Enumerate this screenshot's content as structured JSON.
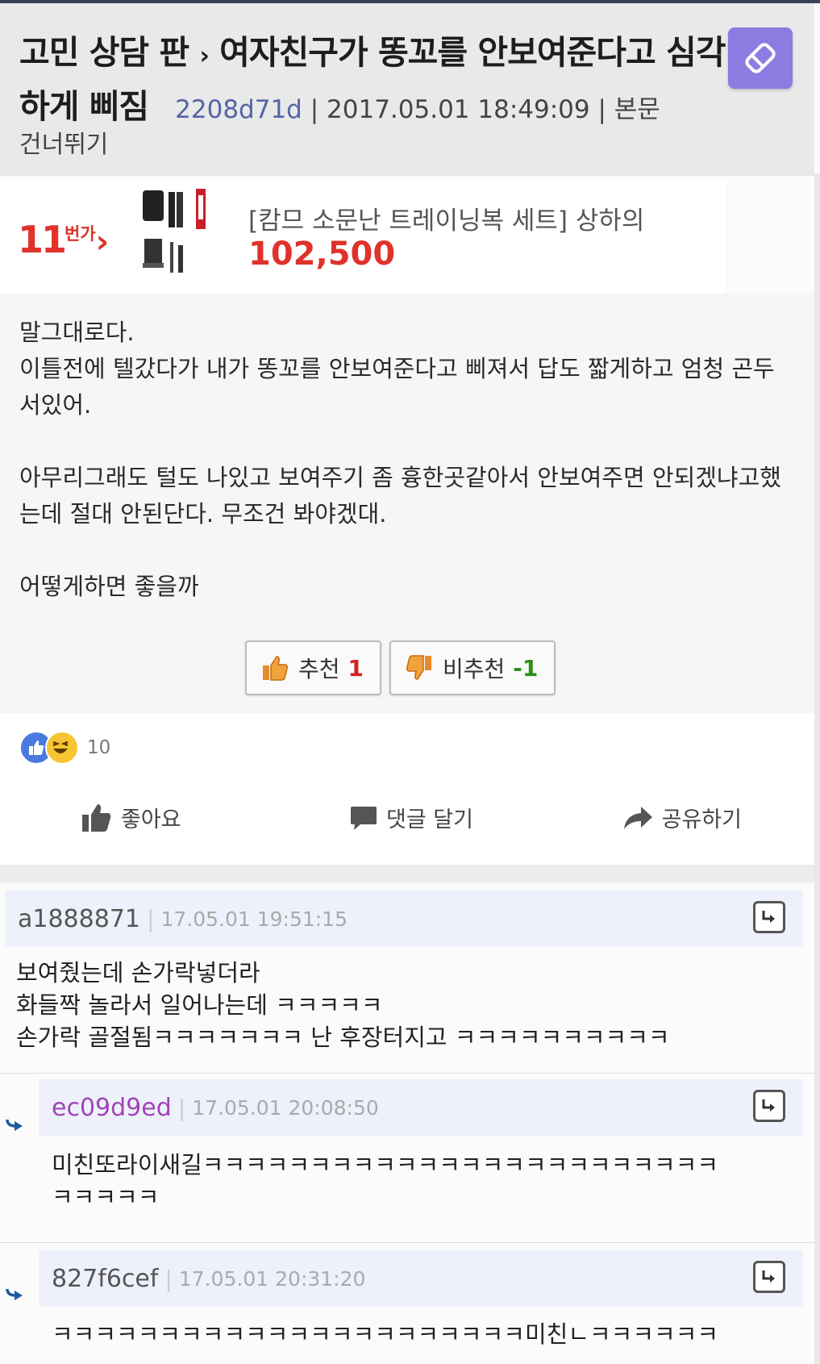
{
  "header": {
    "board": "고민 상담 판",
    "separator": "›",
    "title": "여자친구가 똥꼬를 안보여준다고 심각하게 삐짐",
    "author": "2208d71d",
    "datetime": "2017.05.01 18:49:09",
    "skip_label_1": "본문",
    "skip_label_2": "건너뛰기",
    "write_icon": "pencil-eraser-icon"
  },
  "ad": {
    "logo": "11",
    "logo_suffix": "번가",
    "product_name": "[캄므 소문난 트레이닝복 세트] 상하의",
    "price": "102,500"
  },
  "post": {
    "lines": [
      "말그대로다.",
      "이틀전에 텔갔다가 내가 똥꼬를 안보여준다고 삐져서 답도 짧게하고 엄청 곤두서있어.",
      "",
      "아무리그래도 털도 나있고 보여주기 좀 흉한곳같아서 안보여주면 안되겠냐고했는데 절대 안된단다. 무조건 봐야겠대.",
      "",
      "어떻게하면 좋을까"
    ],
    "upvote_label": "추천",
    "upvote_count": "1",
    "downvote_label": "비추천",
    "downvote_count": "-1"
  },
  "social": {
    "reaction_count": "10",
    "like_label": "좋아요",
    "comment_label": "댓글 달기",
    "share_label": "공유하기"
  },
  "comments": [
    {
      "id": "a1888871",
      "time": "17.05.01 19:51:15",
      "body": "보여줬는데 손가락넣더라\n화들짝 놀라서 일어나는데 ㅋㅋㅋㅋㅋ\n손가락 골절됨ㅋㅋㅋㅋㅋㅋㅋ 난 후장터지고 ㅋㅋㅋㅋㅋㅋㅋㅋㅋㅋ"
    },
    {
      "id": "ec09d9ed",
      "time": "17.05.01 20:08:50",
      "body": "미친또라이새길ㅋㅋㅋㅋㅋㅋㅋㅋㅋㅋㅋㅋㅋㅋㅋㅋㅋㅋㅋㅋㅋㅋㅋㅋ\nㅋㅋㅋㅋㅋ"
    },
    {
      "id": "827f6cef",
      "time": "17.05.01 20:31:20",
      "body": "ㅋㅋㅋㅋㅋㅋㅋㅋㅋㅋㅋㅋㅋㅋㅋㅋㅋㅋㅋㅋㅋㅋ미친ㄴㅋㅋㅋㅋㅋㅋ"
    }
  ],
  "colors": {
    "header_bg": "#e9e9e9",
    "write_button": "#8a7ce0",
    "author": "#5464a6",
    "ad_red": "#e0322a",
    "reply_id_purple": "#a045b8",
    "comment_head_bg": "#eef1fb"
  }
}
